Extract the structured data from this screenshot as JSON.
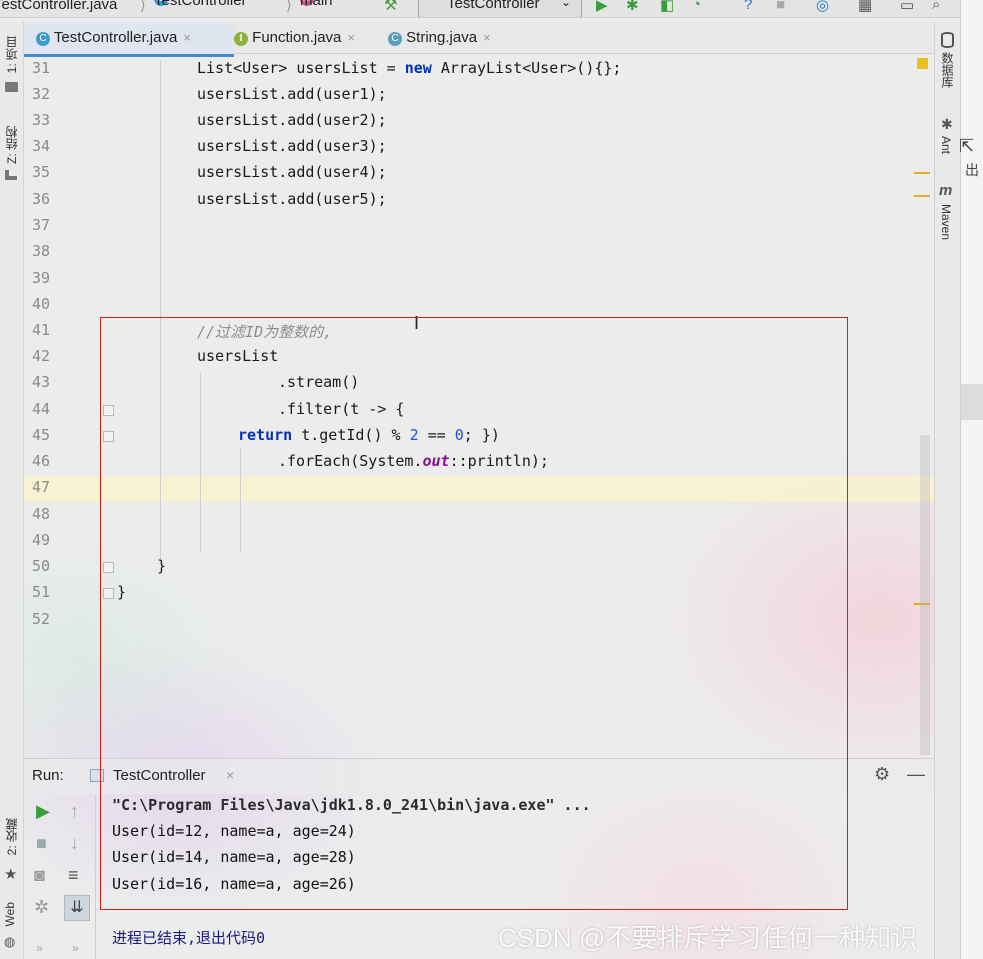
{
  "breadcrumb": {
    "file": "TestController.java",
    "class_badge": "C",
    "class": "TestController",
    "method_badge": "m",
    "method": "main",
    "run_config": "TestController"
  },
  "tabs": [
    {
      "badge": "C",
      "label": "TestController.java",
      "close": "×"
    },
    {
      "badge": "I",
      "label": "Function.java",
      "close": "×"
    },
    {
      "badge": "C",
      "label": "String.java",
      "close": "×"
    }
  ],
  "left_stripe": {
    "project": "1: 项目",
    "structure": "Z: 结构",
    "favorites": "2: 收藏",
    "web": "Web"
  },
  "right_stripe": {
    "database": "数据库",
    "ant": "Ant",
    "maven": "Maven",
    "far_right_label": "出"
  },
  "editor": {
    "line_numbers": [
      "31",
      "32",
      "33",
      "34",
      "35",
      "36",
      "37",
      "38",
      "39",
      "40",
      "41",
      "42",
      "43",
      "44",
      "45",
      "46",
      "47",
      "48",
      "49",
      "50",
      "51",
      "52"
    ],
    "lines": {
      "l31_a": "List<User> usersList = ",
      "l31_kw": "new",
      "l31_b": " ArrayList<User>(){};",
      "l32": "usersList.add(user1);",
      "l33": "usersList.add(user2);",
      "l34": "usersList.add(user3);",
      "l35": "usersList.add(user4);",
      "l36": "usersList.add(user5);",
      "l41": "//过滤ID为整数的,",
      "l42": "usersList",
      "l43": ".stream()",
      "l44": ".filter(t -> {",
      "l45_kw": "return",
      "l45_a": " t.getId() % ",
      "l45_n1": "2",
      "l45_b": " == ",
      "l45_n2": "0",
      "l45_c": "; })",
      "l46_a": ".forEach(System.",
      "l46_fld": "out",
      "l46_b": "::println);",
      "l50": "}",
      "l51": "}"
    }
  },
  "run": {
    "label": "Run:",
    "tab_label": "TestController",
    "tab_close": "×",
    "output": [
      "\"C:\\Program Files\\Java\\jdk1.8.0_241\\bin\\java.exe\" ...",
      "User(id=12, name=a, age=24)",
      "User(id=14, name=a, age=28)",
      "User(id=16, name=a, age=26)"
    ],
    "exit_message": "进程已结束,退出代码0"
  },
  "watermark": "CSDN @不要排斥学习任何一种知识"
}
